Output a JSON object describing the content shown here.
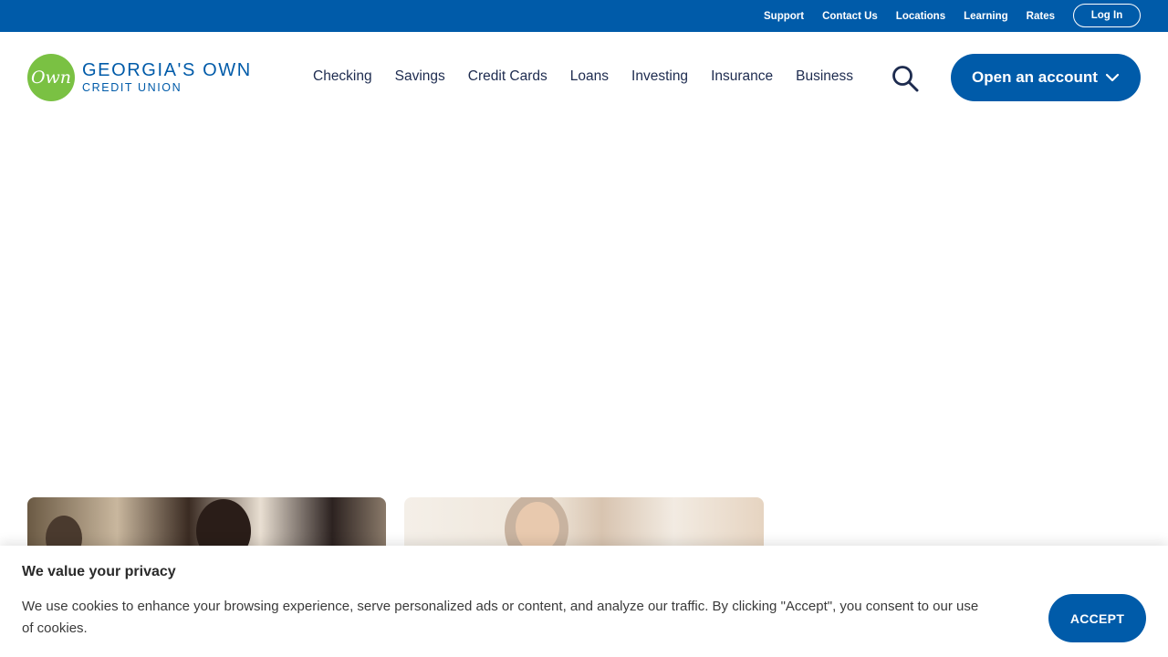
{
  "utility": {
    "links": [
      "Support",
      "Contact Us",
      "Locations",
      "Learning",
      "Rates"
    ],
    "login": "Log In"
  },
  "header": {
    "logo_mark": "Own",
    "logo_name": "GEORGIA'S OWN",
    "logo_sub": "CREDIT UNION",
    "nav": [
      "Checking",
      "Savings",
      "Credit Cards",
      "Loans",
      "Investing",
      "Insurance",
      "Business"
    ],
    "search_icon": "search-icon",
    "open_account": "Open an account"
  },
  "cookie": {
    "title": "We value your privacy",
    "text": "We use cookies to enhance your browsing experience, serve personalized ads or content, and analyze our traffic. By clicking \"Accept\", you consent to our use of cookies.",
    "accept": "ACCEPT"
  },
  "colors": {
    "brand_blue": "#005ba9",
    "brand_green": "#7ac143",
    "text_dark": "#1d2b4f"
  }
}
